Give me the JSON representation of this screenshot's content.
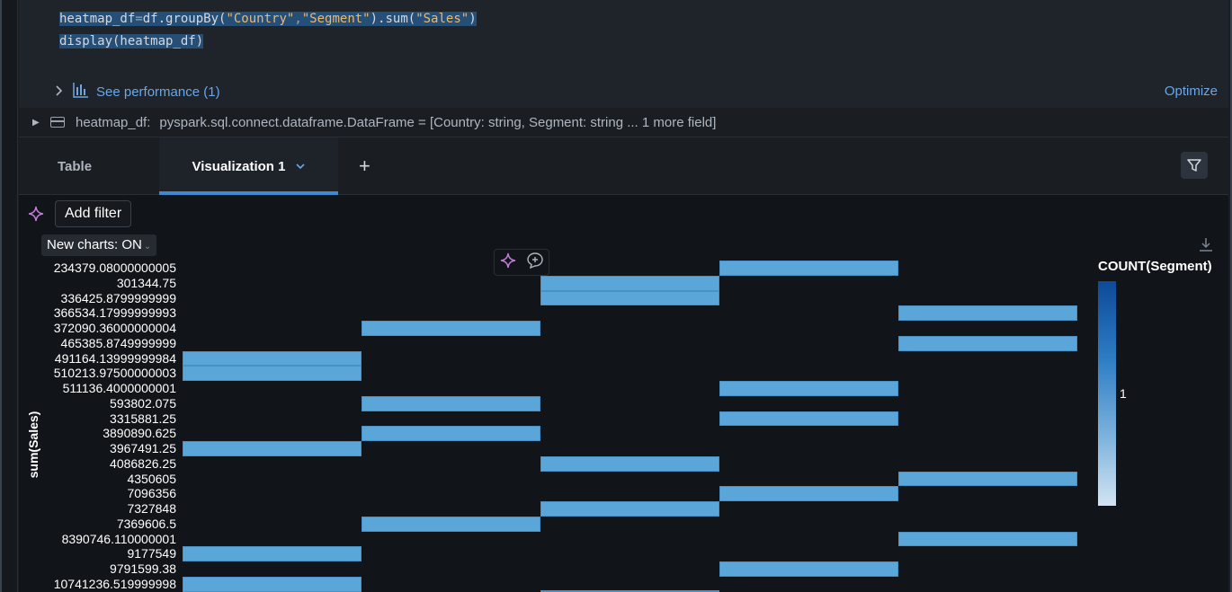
{
  "code": {
    "line1": [
      {
        "t": "heatmap_df",
        "c": "id"
      },
      {
        "t": "=",
        "c": "op"
      },
      {
        "t": "df.groupBy(",
        "c": "id"
      },
      {
        "t": "\"Country\"",
        "c": "str"
      },
      {
        "t": ",",
        "c": "op"
      },
      {
        "t": "\"Segment\"",
        "c": "str"
      },
      {
        "t": ").sum(",
        "c": "id"
      },
      {
        "t": "\"Sales\"",
        "c": "str"
      },
      {
        "t": ")",
        "c": "id"
      }
    ],
    "line2": "display(heatmap_df)"
  },
  "performance": {
    "label": "See performance (1)",
    "optimize": "Optimize"
  },
  "schema": {
    "name": "heatmap_df:",
    "type": "pyspark.sql.connect.dataframe.DataFrame = [Country: string, Segment: string ... 1 more field]"
  },
  "tabs": {
    "table": "Table",
    "visualization": "Visualization 1",
    "add": "+"
  },
  "toolbar": {
    "add_filter": "Add filter",
    "new_charts": "New charts: ON"
  },
  "colors": {
    "cell": "#5ba6d8",
    "accent": "#3e88d4",
    "link": "#6aa7e6"
  },
  "chart_data": {
    "type": "heatmap",
    "ylabel": "sum(Sales)",
    "legend_title": "COUNT(Segment)",
    "legend_tick": "1",
    "y_categories": [
      "234379.08000000005",
      "301344.75",
      "336425.8799999999",
      "366534.17999999993",
      "372090.36000000004",
      "465385.8749999999",
      "491164.13999999984",
      "510213.97500000003",
      "511136.4000000001",
      "593802.075",
      "3315881.25",
      "3890890.625",
      "3967491.25",
      "4086826.25",
      "4350605",
      "7096356",
      "7327848",
      "7369606.5",
      "8390746.110000001",
      "9177549",
      "9791599.38",
      "10741236.519999998"
    ],
    "x_column_count": 5,
    "cells": [
      {
        "col": 3,
        "row": 0,
        "value": 1
      },
      {
        "col": 2,
        "row": 1,
        "value": 1
      },
      {
        "col": 2,
        "row": 2,
        "value": 1
      },
      {
        "col": 4,
        "row": 3,
        "value": 1
      },
      {
        "col": 1,
        "row": 4,
        "value": 1
      },
      {
        "col": 4,
        "row": 5,
        "value": 1
      },
      {
        "col": 0,
        "row": 6,
        "value": 1
      },
      {
        "col": 0,
        "row": 7,
        "value": 1
      },
      {
        "col": 3,
        "row": 8,
        "value": 1
      },
      {
        "col": 1,
        "row": 9,
        "value": 1
      },
      {
        "col": 3,
        "row": 10,
        "value": 1
      },
      {
        "col": 1,
        "row": 11,
        "value": 1
      },
      {
        "col": 0,
        "row": 12,
        "value": 1
      },
      {
        "col": 2,
        "row": 13,
        "value": 1
      },
      {
        "col": 4,
        "row": 14,
        "value": 1
      },
      {
        "col": 3,
        "row": 15,
        "value": 1
      },
      {
        "col": 2,
        "row": 16,
        "value": 1
      },
      {
        "col": 1,
        "row": 17,
        "value": 1
      },
      {
        "col": 4,
        "row": 18,
        "value": 1
      },
      {
        "col": 0,
        "row": 19,
        "value": 1
      },
      {
        "col": 3,
        "row": 20,
        "value": 1
      },
      {
        "col": 0,
        "row": 21,
        "value": 1
      }
    ]
  }
}
